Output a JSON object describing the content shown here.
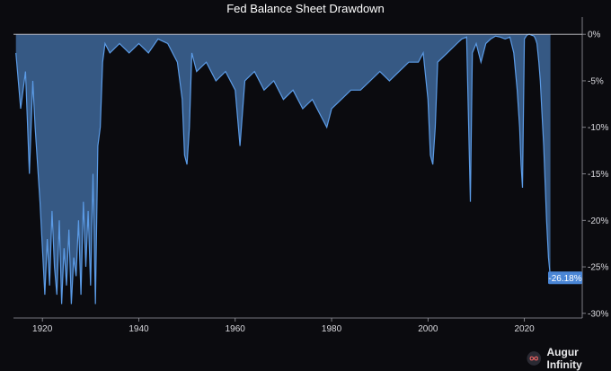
{
  "brand": {
    "name": "Augur Infinity",
    "logo_icon": "infinity-logo-icon"
  },
  "colors": {
    "background": "#0b0b0f",
    "series": "#5b9be6",
    "axis": "#9a9aa2",
    "text": "#ffffff"
  },
  "chart_data": {
    "type": "area",
    "title": "Fed Balance Sheet Drawdown",
    "xlabel": "",
    "ylabel": "",
    "xlim": [
      1914,
      2032
    ],
    "ylim": [
      -30.5,
      0.5
    ],
    "x_ticks": [
      1920,
      1940,
      1960,
      1980,
      2000,
      2020
    ],
    "y_ticks": [
      0,
      -5,
      -10,
      -15,
      -20,
      -25,
      -30
    ],
    "y_tick_labels": [
      "0%",
      "-5%",
      "-10%",
      "-15%",
      "-20%",
      "-25%",
      "-30%"
    ],
    "grid": false,
    "legend": "none",
    "last_value_label": "-26.18%",
    "series": [
      {
        "x": [
          1914.5,
          1915.5,
          1916.5,
          1917.3,
          1918.0,
          1918.5,
          1919.5,
          1920.5,
          1921.0,
          1921.5,
          1922.0,
          1922.5,
          1923.0,
          1923.5,
          1924.0,
          1924.5,
          1925.0,
          1925.5,
          1926.0,
          1926.5,
          1927.0,
          1927.5,
          1928.0,
          1928.5,
          1929.0,
          1929.5,
          1930.0,
          1930.5,
          1931.0,
          1931.5,
          1932.0,
          1932.5,
          1933.0,
          1934.0,
          1936.0,
          1938.0,
          1940.0,
          1942.0,
          1944.0,
          1946.0,
          1948.0,
          1949.0,
          1949.5,
          1950.0,
          1950.5,
          1951.0,
          1952.0,
          1954.0,
          1956.0,
          1958.0,
          1960.0,
          1961.0,
          1962.0,
          1964.0,
          1966.0,
          1968.0,
          1970.0,
          1972.0,
          1974.0,
          1976.0,
          1978.0,
          1979.0,
          1980.0,
          1982.0,
          1984.0,
          1986.0,
          1988.0,
          1990.0,
          1992.0,
          1994.0,
          1996.0,
          1998.0,
          1999.0,
          2000.0,
          2000.5,
          2001.0,
          2001.5,
          2002.0,
          2004.0,
          2006.0,
          2007.0,
          2008.0,
          2008.8,
          2009.2,
          2010.0,
          2011.0,
          2012.0,
          2013.0,
          2014.0,
          2015.0,
          2016.0,
          2017.0,
          2017.8,
          2018.5,
          2019.0,
          2019.3,
          2019.6,
          2020.0,
          2020.5,
          2021.0,
          2021.5,
          2022.0,
          2022.3,
          2022.6,
          2023.0,
          2023.3,
          2023.6,
          2024.0,
          2024.3,
          2024.6,
          2025.0,
          2025.4
        ],
        "values": [
          -2,
          -8,
          -4,
          -15,
          -5,
          -10,
          -18,
          -28,
          -22,
          -27,
          -19,
          -25,
          -28,
          -20,
          -29,
          -23,
          -27,
          -21,
          -29,
          -24,
          -26,
          -20,
          -28,
          -18,
          -25,
          -19,
          -27,
          -15,
          -29,
          -12,
          -10,
          -3,
          -1,
          -2,
          -1,
          -2,
          -1,
          -2,
          -0.5,
          -1,
          -3,
          -7,
          -13,
          -14,
          -10,
          -2,
          -4,
          -3,
          -5,
          -4,
          -6,
          -12,
          -5,
          -4,
          -6,
          -5,
          -7,
          -6,
          -8,
          -7,
          -9,
          -10,
          -8,
          -7,
          -6,
          -6,
          -5,
          -4,
          -5,
          -4,
          -3,
          -3,
          -2,
          -7,
          -13,
          -14,
          -10,
          -3,
          -2,
          -1,
          -0.5,
          -0.3,
          -18,
          -2,
          -1,
          -3,
          -1,
          -0.5,
          -0.2,
          -0.3,
          -0.5,
          -0.3,
          -2,
          -6,
          -10,
          -14,
          -16.5,
          -0.5,
          -0.1,
          0,
          -0.1,
          -0.2,
          -0.5,
          -1,
          -3,
          -5,
          -8,
          -12,
          -16,
          -20,
          -24,
          -26.18
        ]
      }
    ]
  }
}
